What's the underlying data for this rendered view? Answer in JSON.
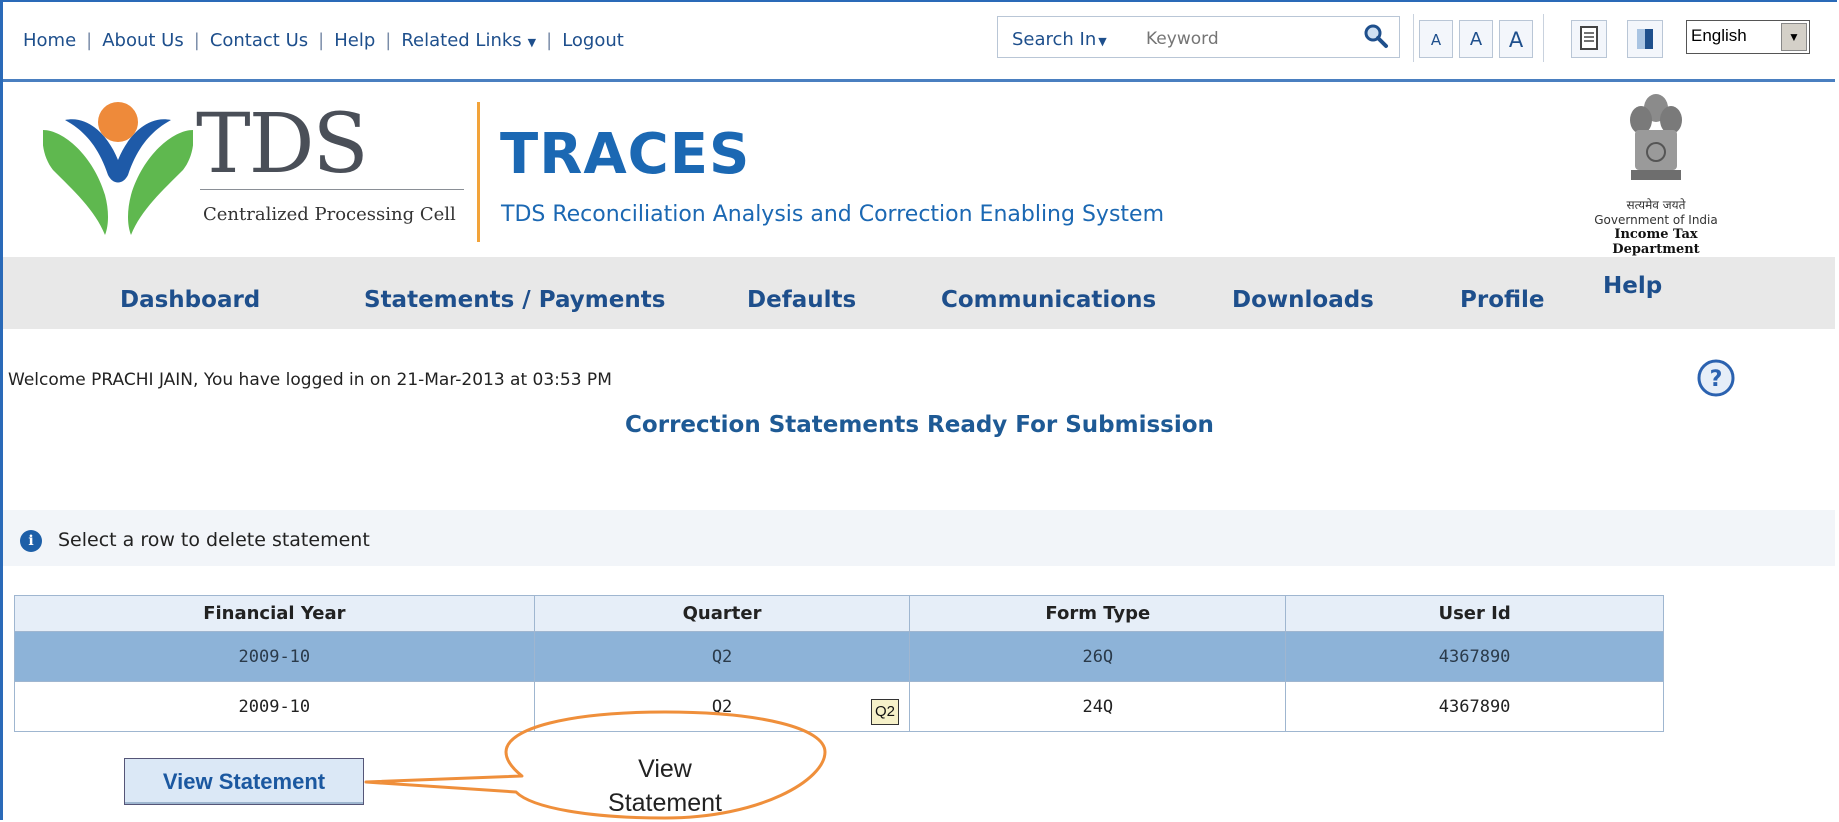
{
  "topbar": {
    "links": [
      "Home",
      "About Us",
      "Contact Us",
      "Help",
      "Related Links",
      "Logout"
    ],
    "search_in_label": "Search In",
    "keyword_placeholder": "Keyword",
    "font_sizes": [
      "A",
      "A",
      "A"
    ],
    "language": "English"
  },
  "brand": {
    "logo_text": "TDS",
    "logo_sub": "Centralized Processing Cell",
    "app_name": "TRACES",
    "tagline": "TDS Reconciliation Analysis and Correction Enabling System",
    "emblem_hindi": "सत्यमेव जयते",
    "emblem_gov": "Government of India",
    "emblem_dept": "Income Tax Department"
  },
  "nav": {
    "items": [
      "Dashboard",
      "Statements / Payments",
      "Defaults",
      "Communications",
      "Downloads",
      "Profile",
      "Help"
    ]
  },
  "welcome": {
    "prefix": "Welcome ",
    "user": "PRACHI JAIN",
    "suffix": ", You have logged in on 21-Mar-2013 at 03:53 PM"
  },
  "page": {
    "title": "Correction Statements Ready For Submission",
    "info": "Select a row to delete statement"
  },
  "table": {
    "headers": [
      "Financial Year",
      "Quarter",
      "Form Type",
      "User Id"
    ],
    "rows": [
      {
        "fy": "2009-10",
        "quarter": "Q2",
        "form": "26Q",
        "user": "4367890",
        "selected": true
      },
      {
        "fy": "2009-10",
        "quarter": "Q2",
        "form": "24Q",
        "user": "4367890",
        "selected": false
      }
    ],
    "tooltip": "Q2"
  },
  "actions": {
    "view_statement": "View Statement"
  },
  "callout": {
    "line1": "View",
    "line2": "Statement",
    "color": "#ef8f3b"
  }
}
